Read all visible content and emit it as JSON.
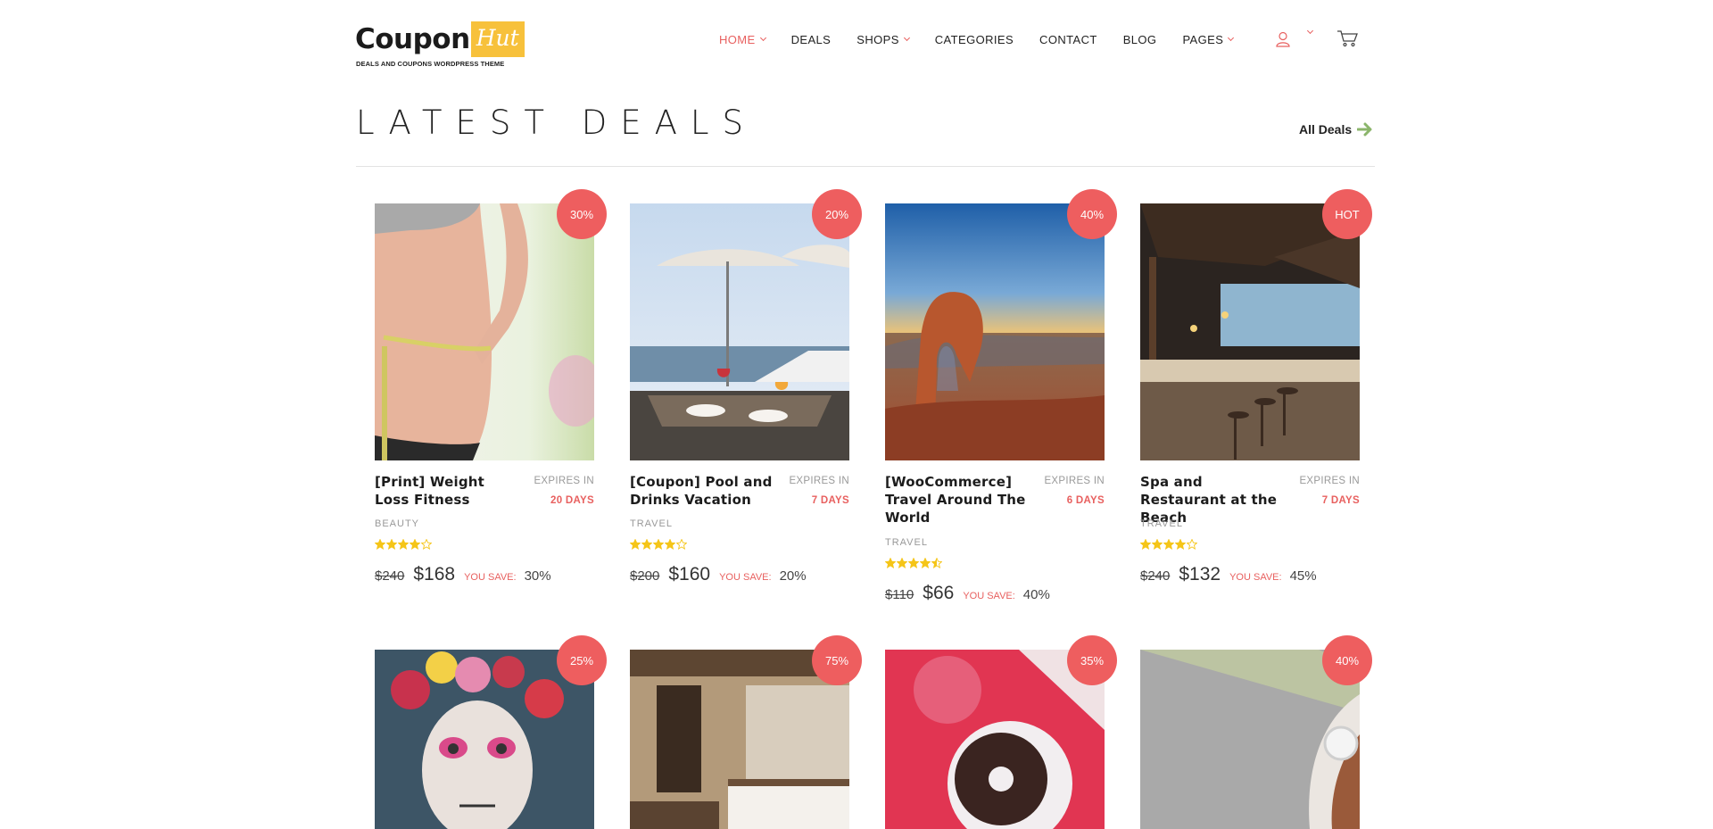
{
  "brand": {
    "name": "Coupon",
    "name_accent": "Hut",
    "tagline": "DEALS AND COUPONS WORDPRESS THEME",
    "accent_color": "#e8605f",
    "logo_color": "#f7c13b"
  },
  "nav": {
    "items": [
      {
        "label": "HOME",
        "dropdown": true,
        "active": true
      },
      {
        "label": "DEALS",
        "dropdown": false,
        "active": false
      },
      {
        "label": "SHOPS",
        "dropdown": true,
        "active": false
      },
      {
        "label": "CATEGORIES",
        "dropdown": false,
        "active": false
      },
      {
        "label": "CONTACT",
        "dropdown": false,
        "active": false
      },
      {
        "label": "BLOG",
        "dropdown": false,
        "active": false
      },
      {
        "label": "PAGES",
        "dropdown": true,
        "active": false
      }
    ],
    "user_icon": "user-icon",
    "cart_icon": "cart-icon"
  },
  "section": {
    "title": "LATEST DEALS",
    "all_deals_label": "All Deals"
  },
  "deals": [
    {
      "badge": "30%",
      "title": "[Print] Weight Loss Fitness",
      "expires_label": "EXPIRES IN",
      "expires_value": "20 DAYS",
      "category": "BEAUTY",
      "rating": 4,
      "old_price": "$240",
      "new_price": "$168",
      "save_label": "YOU SAVE:",
      "save_value": "30%"
    },
    {
      "badge": "20%",
      "title": "[Coupon] Pool and Drinks Vacation",
      "expires_label": "EXPIRES IN",
      "expires_value": "7 DAYS",
      "category": "TRAVEL",
      "rating": 4,
      "old_price": "$200",
      "new_price": "$160",
      "save_label": "YOU SAVE:",
      "save_value": "20%"
    },
    {
      "badge": "40%",
      "title": "[WooCommerce] Travel Around The World",
      "expires_label": "EXPIRES IN",
      "expires_value": "6 DAYS",
      "category": "TRAVEL",
      "rating": 4.5,
      "old_price": "$110",
      "new_price": "$66",
      "save_label": "YOU SAVE:",
      "save_value": "40%"
    },
    {
      "badge": "HOT",
      "title": "Spa and Restaurant at the Beach",
      "expires_label": "EXPIRES IN",
      "expires_value": "7 DAYS",
      "category": "TRAVEL",
      "rating": 4,
      "old_price": "$240",
      "new_price": "$132",
      "save_label": "YOU SAVE:",
      "save_value": "45%"
    },
    {
      "badge": "25%"
    },
    {
      "badge": "75%"
    },
    {
      "badge": "35%"
    },
    {
      "badge": "40%"
    }
  ]
}
